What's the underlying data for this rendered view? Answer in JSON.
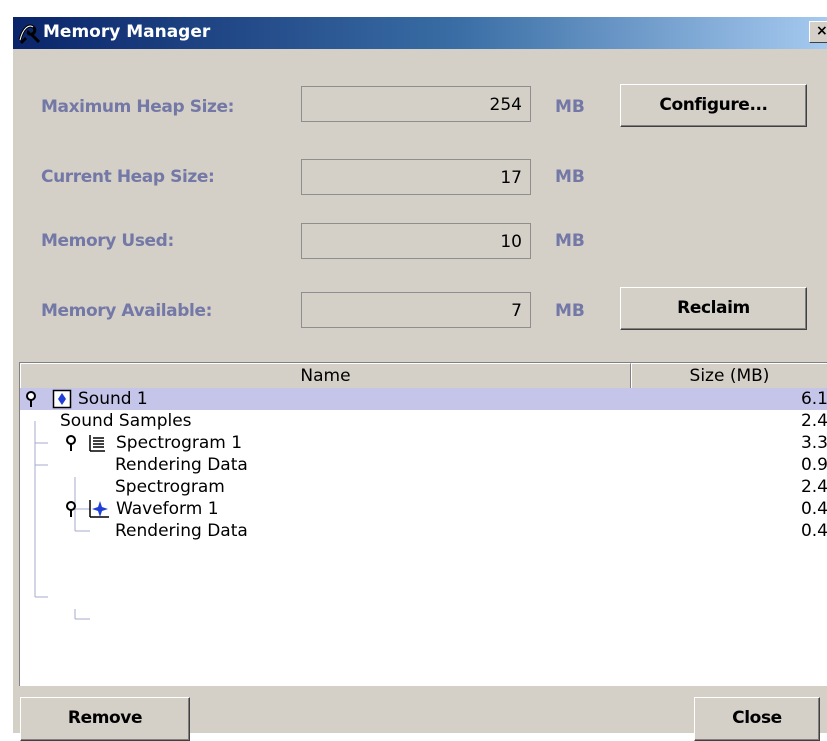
{
  "window": {
    "title": "Memory Manager",
    "close_glyph": "×"
  },
  "stats": {
    "max_heap_label": "Maximum Heap Size:",
    "max_heap_value": "254",
    "current_heap_label": "Current Heap Size:",
    "current_heap_value": "17",
    "used_label": "Memory Used:",
    "used_value": "10",
    "available_label": "Memory Available:",
    "available_value": "7",
    "unit": "MB"
  },
  "buttons": {
    "configure": "Configure...",
    "reclaim": "Reclaim",
    "remove": "Remove",
    "close": "Close"
  },
  "table": {
    "columns": [
      "Name",
      "Size (MB)"
    ],
    "rows": [
      {
        "name": "Sound 1",
        "size": "6.1",
        "icon": "sound-icon",
        "selected": true
      },
      {
        "name": "Sound Samples",
        "size": "2.4",
        "icon": "",
        "selected": false
      },
      {
        "name": "Spectrogram 1",
        "size": "3.3",
        "icon": "spectrogram-icon",
        "selected": false
      },
      {
        "name": "Rendering Data",
        "size": "0.9",
        "icon": "",
        "selected": false
      },
      {
        "name": "Spectrogram",
        "size": "2.4",
        "icon": "",
        "selected": false
      },
      {
        "name": "Waveform 1",
        "size": "0.4",
        "icon": "waveform-icon",
        "selected": false
      },
      {
        "name": "Rendering Data",
        "size": "0.4",
        "icon": "",
        "selected": false
      }
    ]
  },
  "colors": {
    "label_color": "#7378a6",
    "selection": "#c5c5ea",
    "title_gradient_start": "#0a246a",
    "title_gradient_end": "#a6caf0"
  }
}
